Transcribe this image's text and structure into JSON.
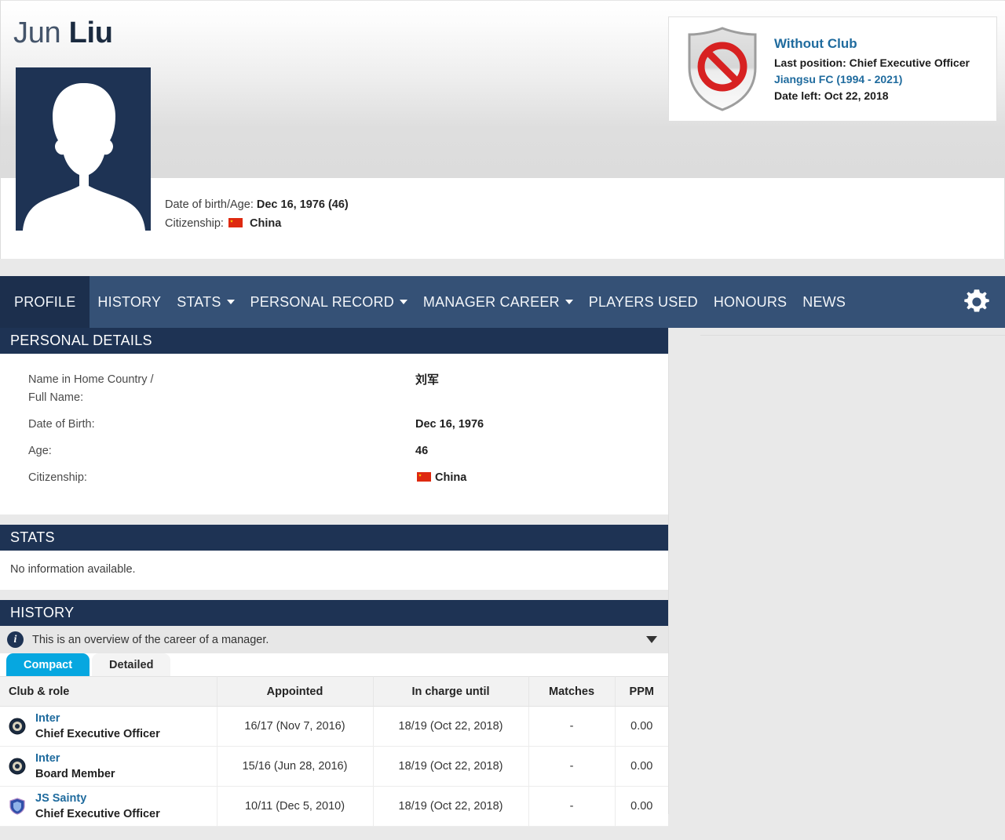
{
  "header": {
    "first_name": "Jun",
    "last_name": "Liu",
    "dob_label": "Date of birth/Age:",
    "dob_value": "Dec 16, 1976 (46)",
    "citizenship_label": "Citizenship:",
    "citizenship_value": "China",
    "photo_icon": "player-silhouette"
  },
  "club_card": {
    "crest_icon": "without-club-shield",
    "title": "Without Club",
    "last_position": "Last position: Chief Executive Officer",
    "club_link": "Jiangsu FC (1994 - 2021)",
    "date_left": "Date left: Oct 22, 2018"
  },
  "nav": {
    "items": [
      {
        "label": "Profile",
        "active": true,
        "caret": false
      },
      {
        "label": "History",
        "active": false,
        "caret": false
      },
      {
        "label": "Stats",
        "active": false,
        "caret": true
      },
      {
        "label": "Personal Record",
        "active": false,
        "caret": true
      },
      {
        "label": "Manager Career",
        "active": false,
        "caret": true
      },
      {
        "label": "Players used",
        "active": false,
        "caret": false
      },
      {
        "label": "Honours",
        "active": false,
        "caret": false
      },
      {
        "label": "News",
        "active": false,
        "caret": false
      }
    ],
    "settings_icon": "gear-icon"
  },
  "personal_details": {
    "heading": "Personal Details",
    "rows": [
      {
        "label": "Name in Home Country /",
        "label2": "Full Name:",
        "value": "刘军"
      },
      {
        "label": "Date of Birth:",
        "value": "Dec 16, 1976"
      },
      {
        "label": "Age:",
        "value": "46"
      },
      {
        "label": "Citizenship:",
        "value": "China"
      }
    ]
  },
  "stats": {
    "heading": "Stats",
    "empty_text": "No information available."
  },
  "history": {
    "heading": "History",
    "info_icon": "info-icon",
    "info_text": "This is an overview of the career of a manager.",
    "collapse_icon": "chevron-down-icon",
    "tabs": [
      {
        "label": "Compact",
        "active": true
      },
      {
        "label": "Detailed",
        "active": false
      }
    ],
    "columns": [
      "Club & role",
      "Appointed",
      "In charge until",
      "Matches",
      "PPM"
    ],
    "rows": [
      {
        "badge": "inter-crest",
        "club": "Inter",
        "role": "Chief Executive Officer",
        "appointed": "16/17 (Nov 7, 2016)",
        "in_charge_until": "18/19 (Oct 22, 2018)",
        "matches": "-",
        "ppm": "0.00"
      },
      {
        "badge": "inter-crest",
        "club": "Inter",
        "role": "Board Member",
        "appointed": "15/16 (Jun 28, 2016)",
        "in_charge_until": "18/19 (Oct 22, 2018)",
        "matches": "-",
        "ppm": "0.00"
      },
      {
        "badge": "js-sainty-crest",
        "club": "JS Sainty",
        "role": "Chief Executive Officer",
        "appointed": "10/11 (Dec 5, 2010)",
        "in_charge_until": "18/19 (Oct 22, 2018)",
        "matches": "-",
        "ppm": "0.00"
      }
    ]
  },
  "colors": {
    "nav_bg": "#355176",
    "nav_active": "#1c2f4d",
    "box_head": "#1e3354",
    "link": "#1f6b9e",
    "tab_active": "#06a7e0",
    "page_bg": "#e9e9e9",
    "flag_red": "#de2910"
  }
}
